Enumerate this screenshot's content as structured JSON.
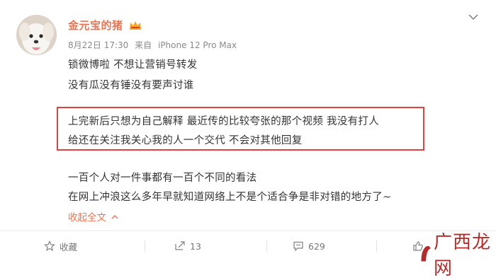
{
  "post": {
    "username": "金元宝的猪",
    "meta": {
      "date": "8月22日 17:30",
      "source_prefix": "来自",
      "device": "iPhone 12 Pro Max"
    },
    "lines": [
      "锁微博啦 不想让营销号转发",
      "没有瓜没有锤没有要声讨谁",
      "上完新后只想为自己解释 最近传的比较夸张的那个视频 我没有打人",
      "给还在关注我关心我的人一个交代  不会对其他回复",
      "一百个人对一件事都有一百个不同的看法",
      "在网上冲浪这么多年早就知道网络上不是个适合争是非对错的地方了~"
    ],
    "collapse_label": "收起全文",
    "collapse_icon": "chevron-up-icon",
    "highlight_color": "#e33f3f",
    "username_color": "#eb7350"
  },
  "actions": {
    "favorite": {
      "label": "收藏",
      "icon": "star-icon"
    },
    "repost": {
      "count": "13",
      "icon": "repost-icon"
    },
    "comment": {
      "count": "629",
      "icon": "comment-icon"
    },
    "like": {
      "icon": "like-icon"
    }
  },
  "watermark": {
    "text": "广西龙网"
  }
}
